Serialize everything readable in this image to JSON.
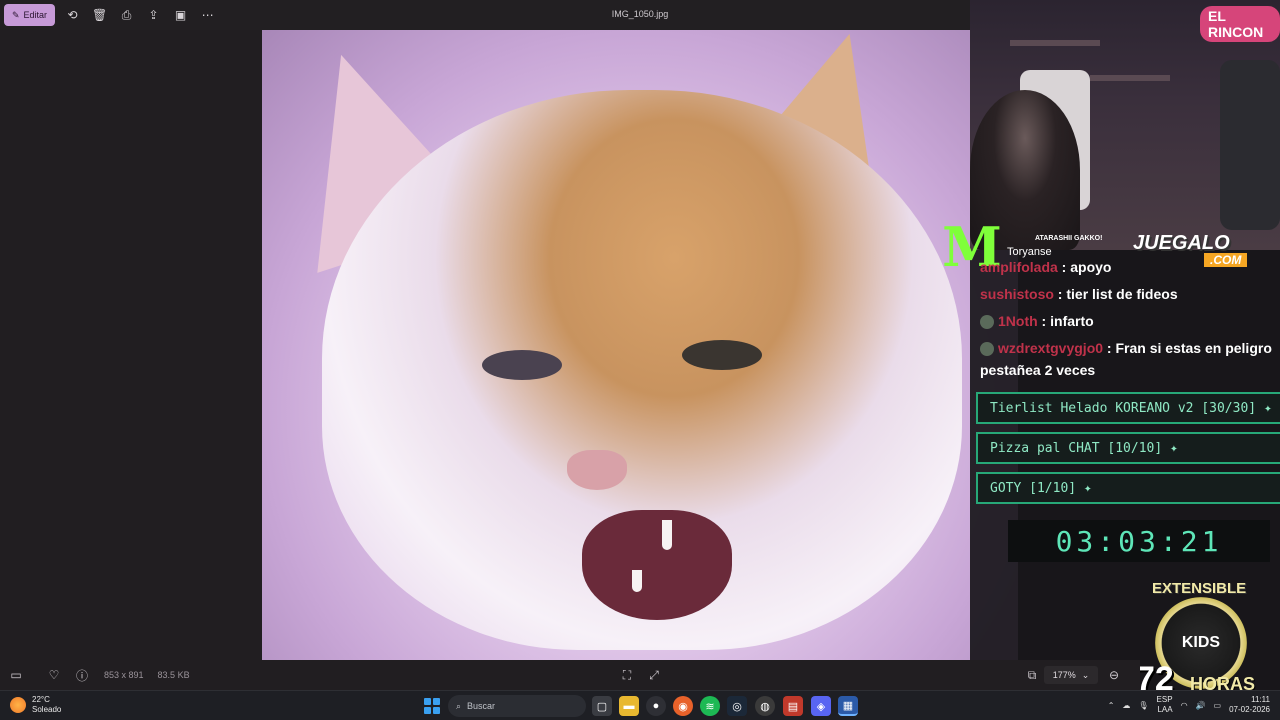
{
  "toolbar": {
    "edit_label": "Editar",
    "file_name": "IMG_1050.jpg"
  },
  "image_info": {
    "dimensions": "853 x 891",
    "file_size": "83.5 KB",
    "zoom": "177%"
  },
  "stream": {
    "sign_text": "EL RINCON",
    "song_artist": "ATARASHII GAKKO!",
    "song_title": "Toryanse",
    "brand": "JUEGALO",
    "brand_suffix": ".COM",
    "chat": [
      {
        "user": "amplifolada",
        "message": "apoyo"
      },
      {
        "user": "sushistoso",
        "message": "tier list de fideos"
      },
      {
        "user": "1Noth",
        "message": "infarto"
      },
      {
        "user": "wzdrextgvygjo0",
        "message": "Fran si estas en peligro pestañea 2 veces"
      }
    ],
    "goals": [
      "Tierlist Helado KOREANO v2 [30/30]",
      "Pizza pal CHAT [10/10]",
      "GOTY [1/10]"
    ],
    "goal_mark": "✦",
    "timer": "03:03:21",
    "extensible": "EXTENSIBLE",
    "badge_text": "KIDS",
    "hours_number": "72",
    "hours_word": "HORAS"
  },
  "taskbar": {
    "temperature": "22°C",
    "condition": "Soleado",
    "search_placeholder": "Buscar",
    "lang_top": "ESP",
    "lang_bottom": "LAA",
    "time": "11:11",
    "date": "07-02-2026"
  },
  "colors": {
    "accent_edit": "#c79ad8",
    "goal_border": "#27a878",
    "timer_text": "#5ee6b8",
    "chat_user": "#c0324a"
  }
}
